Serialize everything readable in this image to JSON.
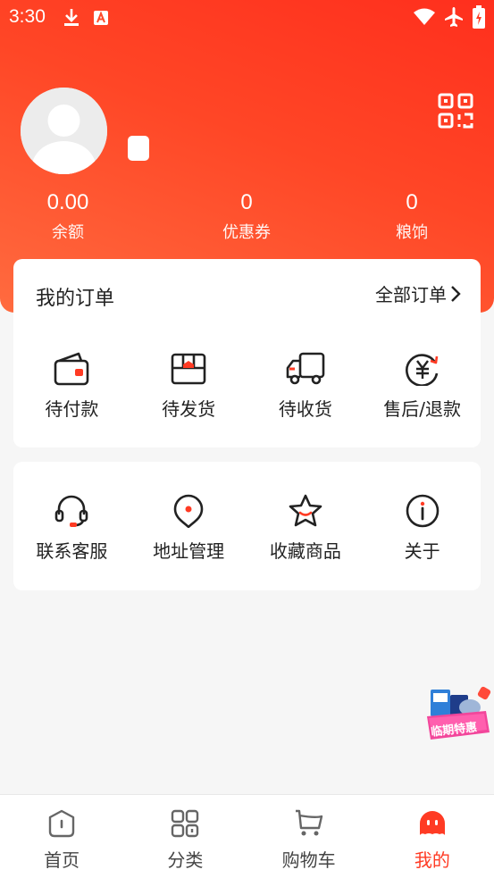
{
  "status_bar": {
    "time": "3:30",
    "left_icons": [
      "download-icon",
      "font-a-icon"
    ],
    "right_icons": [
      "wifi-icon",
      "airplane-icon",
      "battery-charging-icon"
    ]
  },
  "profile": {
    "avatar": "avatar-placeholder-icon",
    "qr_icon": "qr-code-icon"
  },
  "stats": [
    {
      "value": "0.00",
      "label": "余额"
    },
    {
      "value": "0",
      "label": "优惠券"
    },
    {
      "value": "0",
      "label": "粮饷"
    }
  ],
  "orders": {
    "title": "我的订单",
    "all_link": "全部订单",
    "items": [
      {
        "label": "待付款",
        "icon": "wallet-icon"
      },
      {
        "label": "待发货",
        "icon": "package-box-icon"
      },
      {
        "label": "待收货",
        "icon": "delivery-truck-icon"
      },
      {
        "label": "售后/退款",
        "icon": "refund-yuan-icon"
      }
    ]
  },
  "services": {
    "items": [
      {
        "label": "联系客服",
        "icon": "headset-icon"
      },
      {
        "label": "地址管理",
        "icon": "location-pin-icon"
      },
      {
        "label": "收藏商品",
        "icon": "star-icon"
      },
      {
        "label": "关于",
        "icon": "info-icon"
      }
    ]
  },
  "promo": {
    "label": "临期特惠"
  },
  "tabbar": {
    "items": [
      {
        "label": "首页",
        "icon": "home-icon",
        "active": false
      },
      {
        "label": "分类",
        "icon": "category-grid-icon",
        "active": false
      },
      {
        "label": "购物车",
        "icon": "cart-icon",
        "active": false
      },
      {
        "label": "我的",
        "icon": "ghost-profile-icon",
        "active": true
      }
    ]
  },
  "colors": {
    "header_start": "#ff6b3f",
    "header_end": "#ff2f1d",
    "accent": "#ff3b24"
  }
}
